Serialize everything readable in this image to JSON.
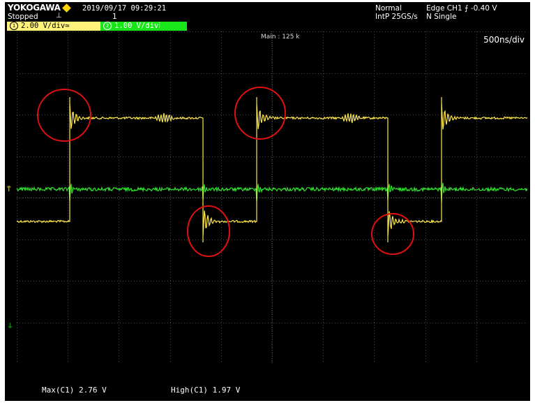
{
  "header": {
    "brand": "YOKOGAWA",
    "datetime": "2019/09/17 09:29:21",
    "status": "Stopped",
    "acq_count": "1",
    "mode": "Normal",
    "sample_rate": "IntP 25GS/s",
    "trigger": "Edge CH1 ⨍ -0.40 V",
    "trigger_mode": "N Single"
  },
  "channels": [
    {
      "number": "1",
      "label": "2.00 V/div",
      "coupling": "≃",
      "color": "#fff27a"
    },
    {
      "number": "2",
      "label": "1.00 V/div",
      "coupling": "⫶",
      "color": "#19e619"
    }
  ],
  "plot": {
    "main_label": "Main : 125 k",
    "timebase": "500ns/div",
    "trig_level_marker": "T̄",
    "ground_marker": "⏚"
  },
  "measurements": {
    "max": "Max(C1)  2.76 V",
    "high": "High(C1)  1.97 V"
  },
  "colors": {
    "ch1": "#ffe84a",
    "ch2": "#2ee62e",
    "grid": "#4a4a4a",
    "highlight": "#e01010"
  },
  "highlights": [
    {
      "name": "ch1-rising-overshoot-1"
    },
    {
      "name": "ch1-falling-undershoot-1"
    },
    {
      "name": "ch1-rising-overshoot-2"
    },
    {
      "name": "ch1-falling-undershoot-2"
    }
  ]
}
